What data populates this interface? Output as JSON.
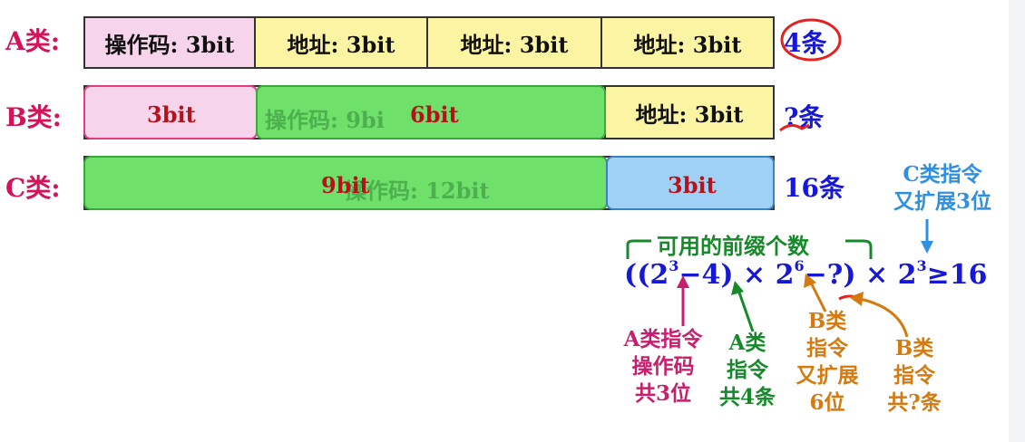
{
  "rows": {
    "a": {
      "label": "A类:",
      "segments": [
        "操作码: 3bit",
        "地址: 3bit",
        "地址: 3bit",
        "地址: 3bit"
      ],
      "count": "4条"
    },
    "b": {
      "label": "B类:",
      "seg1": "3bit",
      "ghost": "操作码: 9bi",
      "seg2": "6bit",
      "seg3": "地址: 3bit",
      "count": "?条"
    },
    "c": {
      "label": "C类:",
      "seg1": "9bit",
      "ghost": "操作码: 12bit",
      "seg2": "3bit",
      "count": "16条"
    }
  },
  "notes": {
    "c_extend": [
      "C类指令",
      "又扩展3位"
    ],
    "brace_label": "可用的前缀个数",
    "a_opcode": [
      "A类指令",
      "操作码",
      "共3位"
    ],
    "a_count": [
      "A类",
      "指令",
      "共4条"
    ],
    "b_extend": [
      "B类",
      "指令",
      "又扩展",
      "6位"
    ],
    "b_count": [
      "B类",
      "指令",
      "共?条"
    ]
  },
  "formula": {
    "open": "((2",
    "exp1": "3",
    "part2": "−4) × 2",
    "exp2": "6",
    "part3": "−?) × 2",
    "exp3": "3",
    "part4": "≥16"
  },
  "colors": {
    "label_magenta": "#d4145a",
    "count_blue": "#1717d6",
    "yellow": "#fbf5a3",
    "pink": "#f6d4ec",
    "green": "#6fe06a",
    "light_blue": "#9fd0f5"
  }
}
